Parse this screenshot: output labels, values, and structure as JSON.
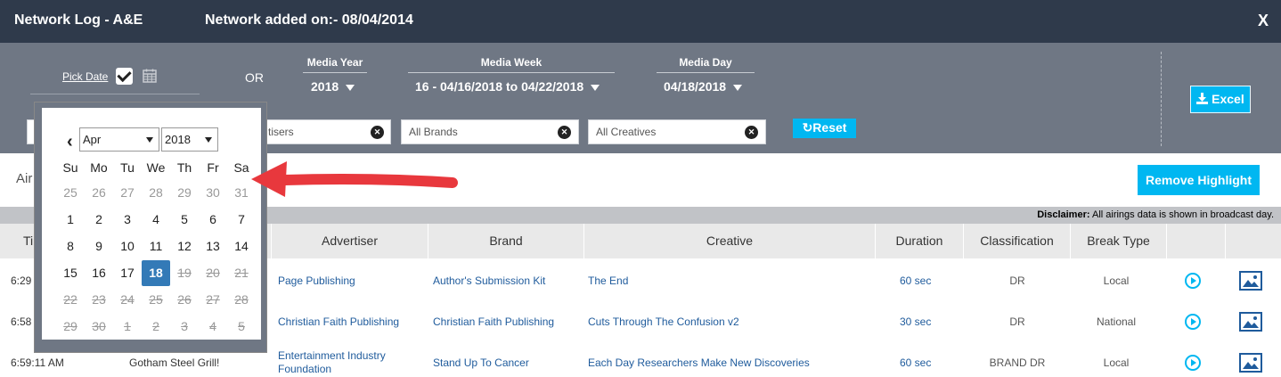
{
  "header": {
    "title": "Network Log - A&E",
    "added": "Network added on:- 08/04/2014",
    "close": "X"
  },
  "filters": {
    "pick_date": "Pick Date",
    "or": "OR",
    "media_year": {
      "label": "Media Year",
      "value": "2018"
    },
    "media_week": {
      "label": "Media Week",
      "value": "16 - 04/16/2018 to 04/22/2018"
    },
    "media_day": {
      "label": "Media Day",
      "value": "04/18/2018"
    },
    "advertisers_placeholder": "tisers",
    "brands_placeholder": "All Brands",
    "creatives_placeholder": "All Creatives",
    "reset": "Reset",
    "excel": "Excel"
  },
  "airings_label": "Air",
  "remove_highlight": "Remove Highlight",
  "disclaimer": {
    "bold": "Disclaimer:",
    "text": " All airings data is shown in broadcast day."
  },
  "table": {
    "headers": [
      "Ti",
      "Advertiser",
      "Brand",
      "Creative",
      "Duration",
      "Classification",
      "Break Type"
    ],
    "rows": [
      {
        "time": "6:29",
        "network_ad": "",
        "advertiser": "Page Publishing",
        "brand": "Author's Submission Kit",
        "creative": "The End",
        "duration": "60 sec",
        "classification": "DR",
        "break_type": "Local"
      },
      {
        "time": "6:58",
        "network_ad": "",
        "advertiser": "Christian Faith Publishing",
        "brand": "Christian Faith Publishing",
        "creative": "Cuts Through The Confusion v2",
        "duration": "30 sec",
        "classification": "DR",
        "break_type": "National"
      },
      {
        "time": "6:59:11 AM",
        "network_ad": "Gotham Steel Grill!",
        "advertiser": "Entertainment Industry Foundation",
        "brand": "Stand Up To Cancer",
        "creative": "Each Day Researchers Make New Discoveries",
        "duration": "60 sec",
        "classification": "BRAND DR",
        "break_type": "Local"
      }
    ]
  },
  "calendar": {
    "month": "Apr",
    "year": "2018",
    "weekdays": [
      "Su",
      "Mo",
      "Tu",
      "We",
      "Th",
      "Fr",
      "Sa"
    ],
    "weeks": [
      [
        "25",
        "26",
        "27",
        "28",
        "29",
        "30",
        "31"
      ],
      [
        "1",
        "2",
        "3",
        "4",
        "5",
        "6",
        "7"
      ],
      [
        "8",
        "9",
        "10",
        "11",
        "12",
        "13",
        "14"
      ],
      [
        "15",
        "16",
        "17",
        "18",
        "19",
        "20",
        "21"
      ],
      [
        "22",
        "23",
        "24",
        "25",
        "26",
        "27",
        "28"
      ],
      [
        "29",
        "30",
        "1",
        "2",
        "3",
        "4",
        "5"
      ]
    ],
    "selected": "18"
  },
  "colors": {
    "accent": "#00b7f1",
    "header_bg": "#2f3a4b",
    "filter_bg": "#6f7784",
    "link": "#1f5b9c",
    "selected_day": "#337ab7",
    "arrow": "#e8383d"
  }
}
